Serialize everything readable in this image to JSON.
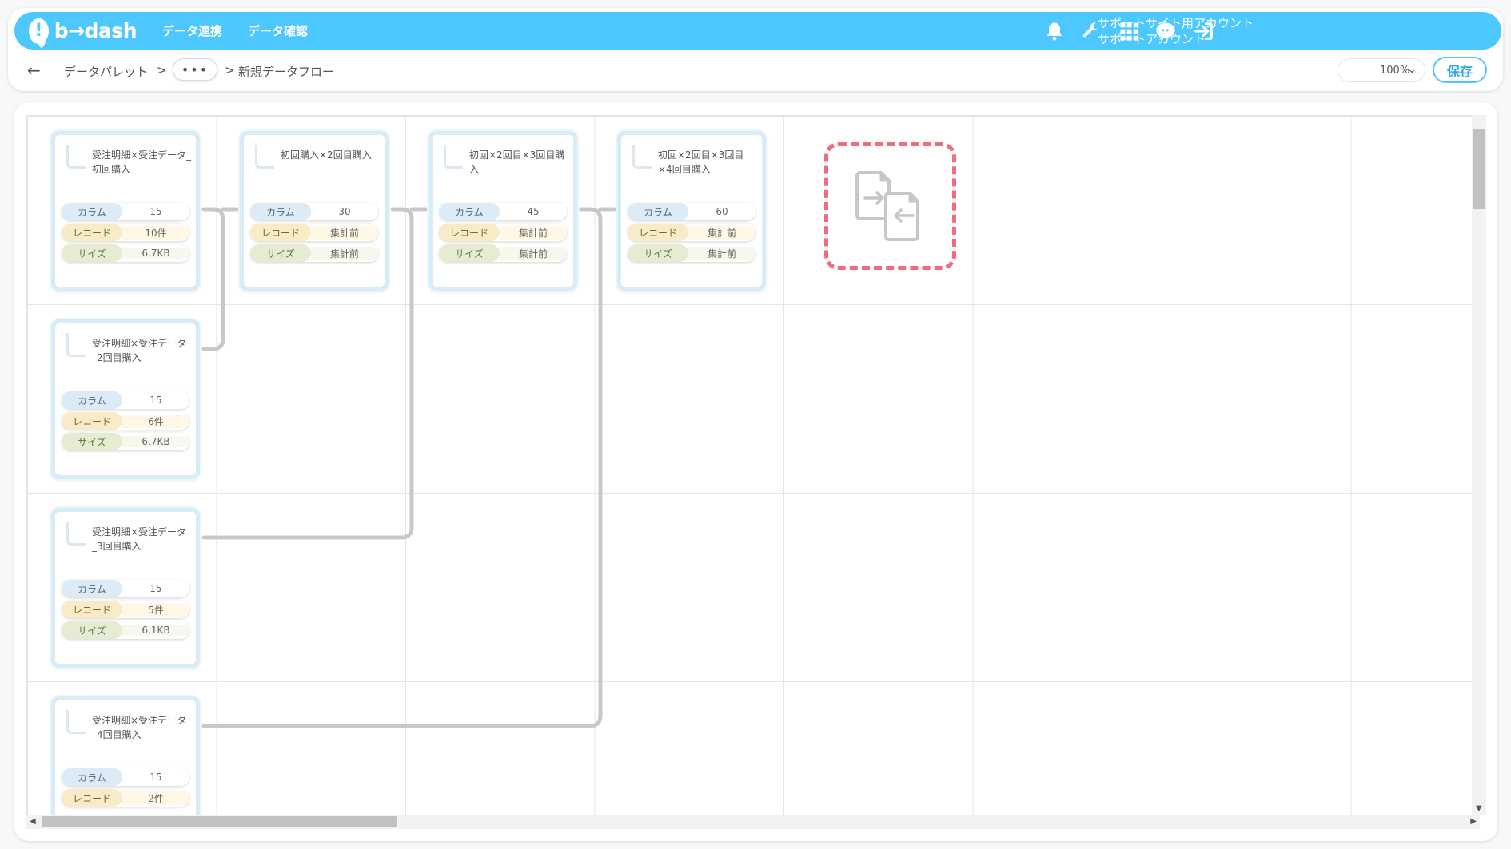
{
  "header": {
    "logo_text": "b→dash",
    "logo_mark": "!",
    "nav": [
      "データ連携",
      "データ確認"
    ],
    "account_line1": "サポートサイト用アカウント",
    "account_line2": "サポートアカウント",
    "icons": [
      "bell-icon",
      "wrench-icon",
      "grid-icon",
      "chat-icon",
      "logout-icon"
    ]
  },
  "breadcrumb": {
    "back": "←",
    "item1": "データパレット",
    "sep1": ">",
    "more": "•••",
    "sep2": ">",
    "current": "新規データフロー"
  },
  "toolbar": {
    "zoom": "100%",
    "zoom_chevron": "⌄",
    "save": "保存"
  },
  "cards": [
    {
      "title": "受注明細×受注データ_初回購入",
      "columns": "15",
      "records": "10件",
      "size": "6.7KB"
    },
    {
      "title": "初回購入×2回目購入",
      "columns": "30",
      "records": "集計前",
      "size": "集計前"
    },
    {
      "title": "初回×2回目×3回目購入",
      "columns": "45",
      "records": "集計前",
      "size": "集計前"
    },
    {
      "title": "初回×2回目×3回目×4回目購入",
      "columns": "60",
      "records": "集計前",
      "size": "集計前"
    },
    {
      "title": "受注明細×受注データ_2回目購入",
      "columns": "15",
      "records": "6件",
      "size": "6.7KB"
    },
    {
      "title": "受注明細×受注データ_3回目購入",
      "columns": "15",
      "records": "5件",
      "size": "6.1KB"
    },
    {
      "title": "受注明細×受注データ_4回目購入",
      "columns": "15",
      "records": "2件",
      "size": ""
    }
  ],
  "labels": {
    "columns": "カラム",
    "records": "レコード",
    "size": "サイズ"
  },
  "colors": {
    "header": "#4cc8ff",
    "merge_border": "#f06b7d",
    "connector": "#c8c8c8"
  }
}
